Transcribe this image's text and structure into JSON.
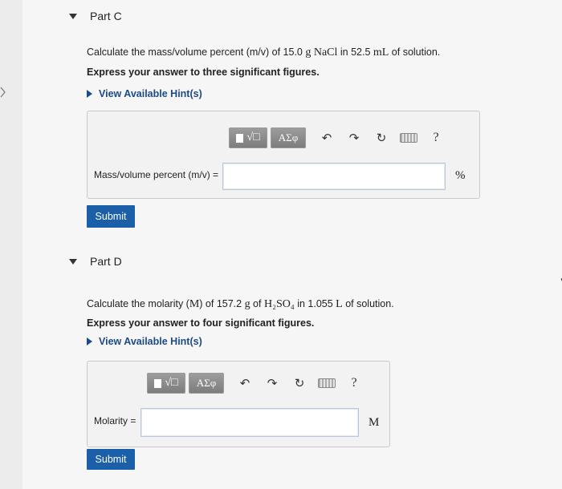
{
  "partC": {
    "title": "Part C",
    "question_pre": "Calculate the mass/volume percent (m/v) of 15.0 ",
    "q_unit1": "g",
    "q_sp1": " ",
    "q_chem": "NaCl",
    "q_mid": " in 52.5 ",
    "q_unit2": "mL",
    "question_post": " of solution.",
    "emphasis": "Express your answer to three significant figures.",
    "hint": "View Available Hint(s)",
    "templates_label": "√□",
    "greek_label": "ΑΣφ",
    "field_label": "Mass/volume percent (m/v) =",
    "field_value": "",
    "unit": "%",
    "submit_label": "Submit"
  },
  "partD": {
    "title": "Part D",
    "question_pre": "Calculate the molarity (",
    "q_M": "M",
    "q_a": ") of 157.2 ",
    "q_unit1": "g",
    "q_of": " of ",
    "q_chem": "H₂SO₄",
    "q_in": " in 1.055 ",
    "q_unit2": "L",
    "question_post": " of solution.",
    "emphasis": "Express your answer to four significant figures.",
    "hint": "View Available Hint(s)",
    "templates_label": "√□",
    "greek_label": "ΑΣφ",
    "field_label": "Molarity =",
    "field_value": "",
    "unit": "M",
    "submit_label": "Submit"
  },
  "toolbar_icons": {
    "undo": "↶",
    "redo": "↷",
    "reset": "↻",
    "help": "?"
  }
}
